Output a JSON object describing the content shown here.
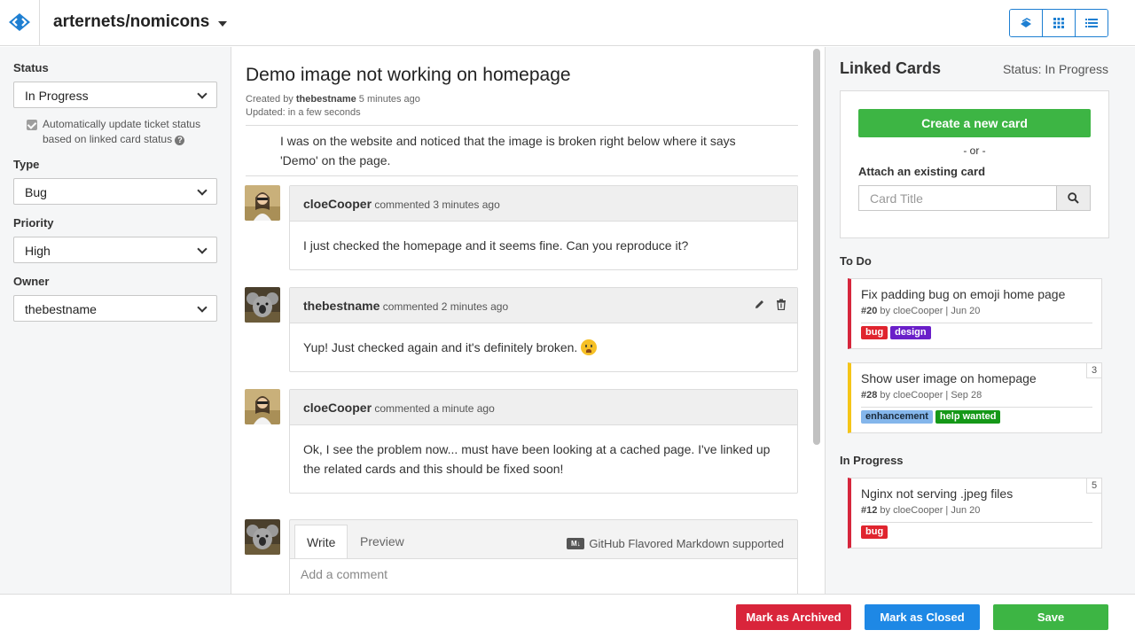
{
  "header": {
    "repo": "arternets/nomicons",
    "logo_icon": "code-brackets-logo-icon",
    "view_icons": [
      "layers-icon",
      "grid-icon",
      "list-icon"
    ],
    "accent": "#1e7fd2"
  },
  "sidebar": {
    "status_label": "Status",
    "status_value": "In Progress",
    "auto_update_text": "Automatically update ticket status based on linked card status",
    "type_label": "Type",
    "type_value": "Bug",
    "priority_label": "Priority",
    "priority_value": "High",
    "owner_label": "Owner",
    "owner_value": "thebestname"
  },
  "ticket": {
    "title": "Demo image not working on homepage",
    "created_prefix": "Created by",
    "created_by": "thebestname",
    "created_ago": "5 minutes ago",
    "updated": "Updated: in a few seconds",
    "description": "I was on the website and noticed that the image is broken right below where it says 'Demo' on the page."
  },
  "comments": [
    {
      "author": "cloeCooper",
      "meta": "commented 3 minutes ago",
      "body": "I just checked the homepage and it seems fine. Can you reproduce it?",
      "avatar": "woman-avatar"
    },
    {
      "author": "thebestname",
      "meta": "commented 2 minutes ago",
      "body": "Yup! Just checked again and it's definitely broken.",
      "avatar": "koala-avatar"
    },
    {
      "author": "cloeCooper",
      "meta": "commented a minute ago",
      "body": "Ok, I see the problem now... must have been looking at a cached page. I've linked up the related cards and this should be fixed soon!",
      "avatar": "woman-avatar"
    }
  ],
  "composer": {
    "tab_write": "Write",
    "tab_preview": "Preview",
    "md_badge": "M↓",
    "md_note": "GitHub Flavored Markdown supported",
    "placeholder": "Add a comment"
  },
  "linked": {
    "title": "Linked Cards",
    "status": "Status: In Progress",
    "create_label": "Create a new card",
    "or_text": "- or -",
    "attach_label": "Attach an existing card",
    "card_title_placeholder": "Card Title",
    "sections": [
      {
        "name": "To Do",
        "cards": [
          {
            "title": "Fix padding bug on emoji home page",
            "id": "#20",
            "by": "by cloeCooper | Jun 20",
            "color": "#d6263c",
            "count": "",
            "tags": [
              {
                "label": "bug",
                "color": "#e0242e"
              },
              {
                "label": "design",
                "color": "#6a1fc9"
              }
            ]
          },
          {
            "title": "Show user image on homepage",
            "id": "#28",
            "by": "by cloeCooper | Sep 28",
            "color": "#f5c518",
            "count": "3",
            "tags": [
              {
                "label": "enhancement",
                "color": "#84b6eb"
              },
              {
                "label": "help wanted",
                "color": "#159818"
              }
            ]
          }
        ]
      },
      {
        "name": "In Progress",
        "cards": [
          {
            "title": "Nginx not serving .jpeg files",
            "id": "#12",
            "by": "by cloeCooper | Jun 20",
            "color": "#d6263c",
            "count": "5",
            "tags": [
              {
                "label": "bug",
                "color": "#e0242e"
              }
            ]
          }
        ]
      }
    ]
  },
  "footer": {
    "archive_label": "Mark as Archived",
    "archive_color": "#d9253b",
    "closed_label": "Mark as Closed",
    "closed_color": "#1e88e5",
    "save_label": "Save",
    "save_color": "#3db544"
  }
}
